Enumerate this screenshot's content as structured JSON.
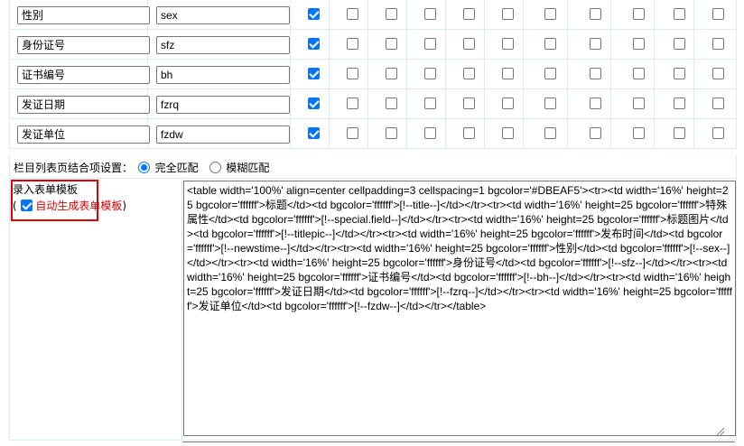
{
  "fields": [
    {
      "name": "性别",
      "var": "sex",
      "checked": [
        true,
        false,
        false,
        false,
        false,
        false,
        false,
        false,
        false,
        false,
        false
      ]
    },
    {
      "name": "身份证号",
      "var": "sfz",
      "checked": [
        true,
        false,
        false,
        false,
        false,
        false,
        false,
        false,
        false,
        false,
        false
      ]
    },
    {
      "name": "证书编号",
      "var": "bh",
      "checked": [
        true,
        false,
        false,
        false,
        false,
        false,
        false,
        false,
        false,
        false,
        false
      ]
    },
    {
      "name": "发证日期",
      "var": "fzrq",
      "checked": [
        true,
        false,
        false,
        false,
        false,
        false,
        false,
        false,
        false,
        false,
        false
      ]
    },
    {
      "name": "发证单位",
      "var": "fzdw",
      "checked": [
        true,
        false,
        false,
        false,
        false,
        false,
        false,
        false,
        false,
        false,
        false
      ]
    }
  ],
  "match": {
    "label": "栏目列表页结合项设置：",
    "options": [
      {
        "label": "完全匹配",
        "selected": true
      },
      {
        "label": "模糊匹配",
        "selected": false
      }
    ]
  },
  "template": {
    "title": "录入表单模板",
    "open_paren": "(",
    "auto_label": "自动生成表单模板",
    "close_paren": ")",
    "auto_checked": true,
    "code": "<table width='100%' align=center cellpadding=3 cellspacing=1 bgcolor='#DBEAF5'><tr><td width='16%' height=25 bgcolor='ffffff'>标题</td><td bgcolor='ffffff'>[!--title--]</td></tr><tr><td width='16%' height=25 bgcolor='ffffff'>特殊属性</td><td bgcolor='ffffff'>[!--special.field--]</td></tr><tr><td width='16%' height=25 bgcolor='ffffff'>标题图片</td><td bgcolor='ffffff'>[!--titlepic--]</td></tr><tr><td width='16%' height=25 bgcolor='ffffff'>发布时间</td><td bgcolor='ffffff'>[!--newstime--]</td></tr><tr><td width='16%' height=25 bgcolor='ffffff'>性别</td><td bgcolor='ffffff'>[!--sex--]</td></tr><tr><td width='16%' height=25 bgcolor='ffffff'>身份证号</td><td bgcolor='ffffff'>[!--sfz--]</td></tr><tr><td width='16%' height=25 bgcolor='ffffff'>证书编号</td><td bgcolor='ffffff'>[!--bh--]</td></tr><tr><td width='16%' height=25 bgcolor='ffffff'>发证日期</td><td bgcolor='ffffff'>[!--fzrq--]</td></tr><tr><td width='16%' height=25 bgcolor='ffffff'>发证单位</td><td bgcolor='ffffff'>[!--fzdw--]</td></tr></table>"
  },
  "colors": {
    "border": "#DBEAF5",
    "accent": "#0075ff",
    "highlight_red": "#e00000"
  }
}
